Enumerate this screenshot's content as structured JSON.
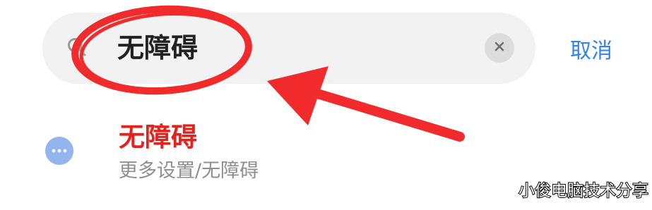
{
  "search": {
    "query": "无障碍",
    "icon": "search-icon",
    "clear_icon": "clear-icon"
  },
  "header": {
    "cancel_label": "取消"
  },
  "results": [
    {
      "title": "无障碍",
      "path": "更多设置/无障碍",
      "icon": "more-icon"
    }
  ],
  "watermark": {
    "text": "小俊电脑技术分享"
  },
  "colors": {
    "accent": "#2f86e8",
    "highlight": "#e4221d",
    "annotation": "#f12b2b",
    "search_bg": "#f2f2f2",
    "result_icon": "#93b5ee"
  }
}
